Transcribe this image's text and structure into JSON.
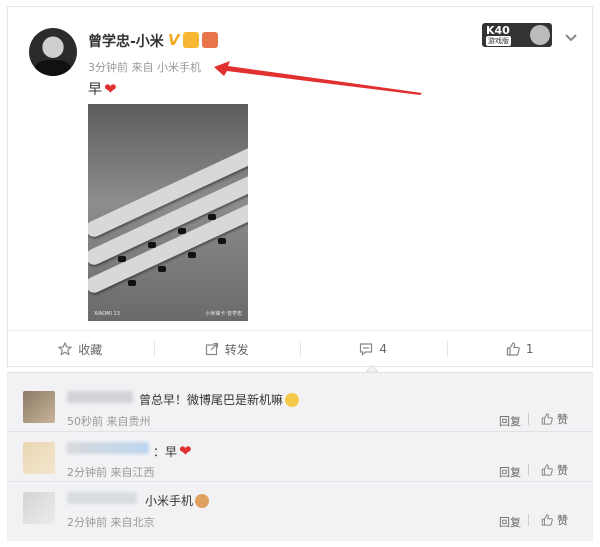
{
  "post": {
    "username": "曾学忠-小米",
    "verified_badge": "V",
    "time": "3分钟前",
    "source": "来自 小米手机",
    "text": "早",
    "photo_brand": "XIAOMI 13",
    "photo_caption": "小米徕卡·曾学忠",
    "promo_title": "K40",
    "promo_tag": "游戏版",
    "accent_color": "#e0302f",
    "badge_color": "#f5a623"
  },
  "actions": {
    "favorite_label": "收藏",
    "share_label": "转发",
    "comment_count": "4",
    "like_count": "1"
  },
  "comments": [
    {
      "text": "曾总早！微博尾巴是新机嘛",
      "time": "50秒前",
      "location": "来自贵州",
      "reply": "回复",
      "like": "赞"
    },
    {
      "text": "：早",
      "time": "2分钟前",
      "location": "来自江西",
      "reply": "回复",
      "like": "赞"
    },
    {
      "text": "小米手机",
      "time": "2分钟前",
      "location": "来自北京",
      "reply": "回复",
      "like": "赞"
    }
  ]
}
